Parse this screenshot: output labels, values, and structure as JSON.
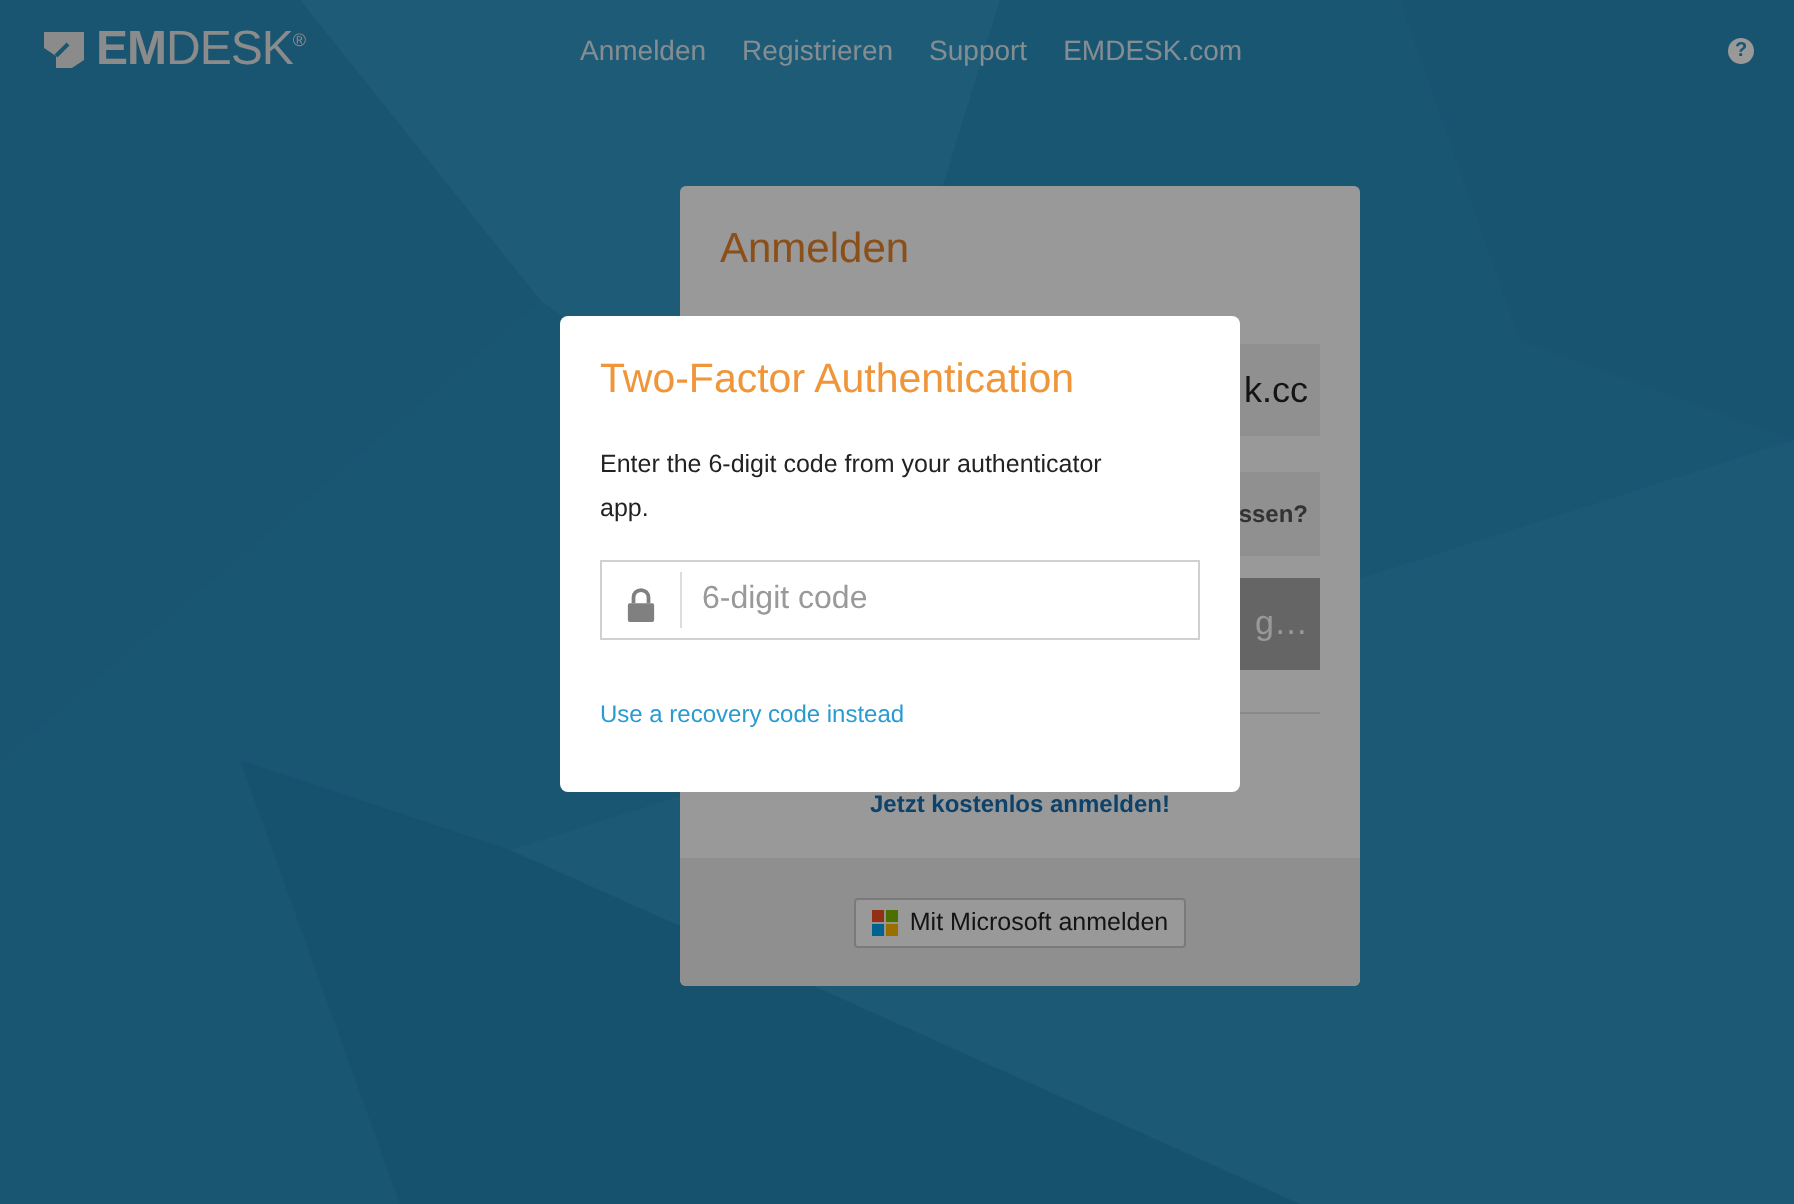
{
  "header": {
    "logo": "**EM**DESK$^{®}$",
    "nav": [
      "Anmelden",
      "Registrieren",
      "Support",
      "EMDESK.com"
    ],
    "help": "?"
  },
  "login_card": {
    "title": "Anmelden",
    "email_field_value": "k.cc",
    "forgot_link": "ssen?",
    "submit_button": "g…",
    "signup_link": "Jetzt kostenlos anmelden!",
    "microsoft_button": "Mit Microsoft anmelden"
  },
  "dialog": {
    "title": "Two-Factor Authentication",
    "message": "Enter the 6-digit code from your authenticator app.",
    "code_field": {
      "placeholder": "6-digit code"
    },
    "recovery_link": "Use a recovery code instead"
  }
}
